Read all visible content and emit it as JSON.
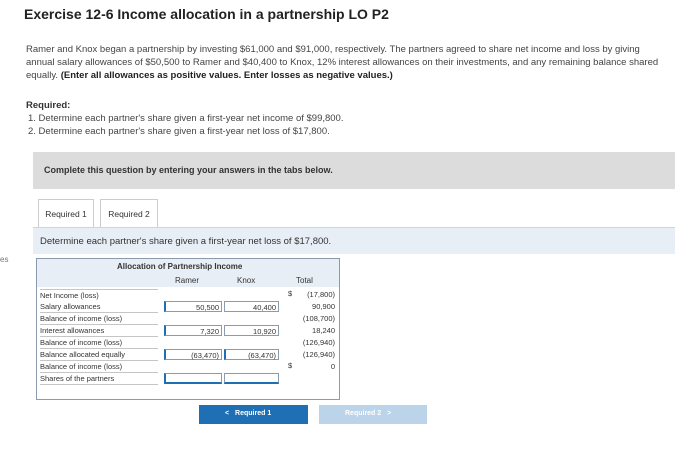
{
  "title": "Exercise 12-6 Income allocation in a partnership LO P2",
  "left_edge_text": "es",
  "problem": {
    "text": "Ramer and Knox began a partnership by investing $61,000 and $91,000, respectively. The partners agreed to share net income and loss by giving annual salary allowances of $50,500 to Ramer and $40,400 to Knox, 12% interest allowances on their investments, and any remaining balance shared equally.",
    "emphasis": "(Enter all allowances as positive values. Enter losses as negative values.)"
  },
  "required": {
    "title": "Required:",
    "items": [
      "1. Determine each partner's share given a first-year net income of $99,800.",
      "2. Determine each partner's share given a first-year net loss of $17,800."
    ]
  },
  "instruction": "Complete this question by entering your answers in the tabs below.",
  "tabs": [
    "Required 1",
    "Required 2"
  ],
  "active_tab_description": "Determine each partner's share given a first-year net loss of $17,800.",
  "table": {
    "title": "Allocation of Partnership Income",
    "columns": [
      "Ramer",
      "Knox",
      "Total"
    ],
    "rows": [
      {
        "label": "Net Income (loss)",
        "ramer": "",
        "knox": "",
        "total": "(17,800)",
        "total_dollar": "$"
      },
      {
        "label": "Salary allowances",
        "ramer": "50,500",
        "knox": "40,400",
        "total": "90,900",
        "ramer_dollar": "$",
        "knox_dollar": "$"
      },
      {
        "label": "Balance of income (loss)",
        "ramer": "",
        "knox": "",
        "total": "(108,700)"
      },
      {
        "label": "Interest allowances",
        "ramer": "7,320",
        "knox": "10,920",
        "total": "18,240"
      },
      {
        "label": "Balance of income (loss)",
        "ramer": "",
        "knox": "",
        "total": "(126,940)"
      },
      {
        "label": "Balance allocated equally",
        "ramer": "(63,470)",
        "knox": "(63,470)",
        "total": "(126,940)"
      },
      {
        "label": "Balance of income (loss)",
        "ramer": "",
        "knox": "",
        "total": "0",
        "total_dollar": "$"
      },
      {
        "label": "Shares of the partners",
        "ramer": "",
        "knox": "",
        "total": ""
      }
    ]
  },
  "nav": {
    "prev_label": "Required 1",
    "next_label": "Required 2",
    "prev_glyph": "<",
    "next_glyph": ">"
  }
}
